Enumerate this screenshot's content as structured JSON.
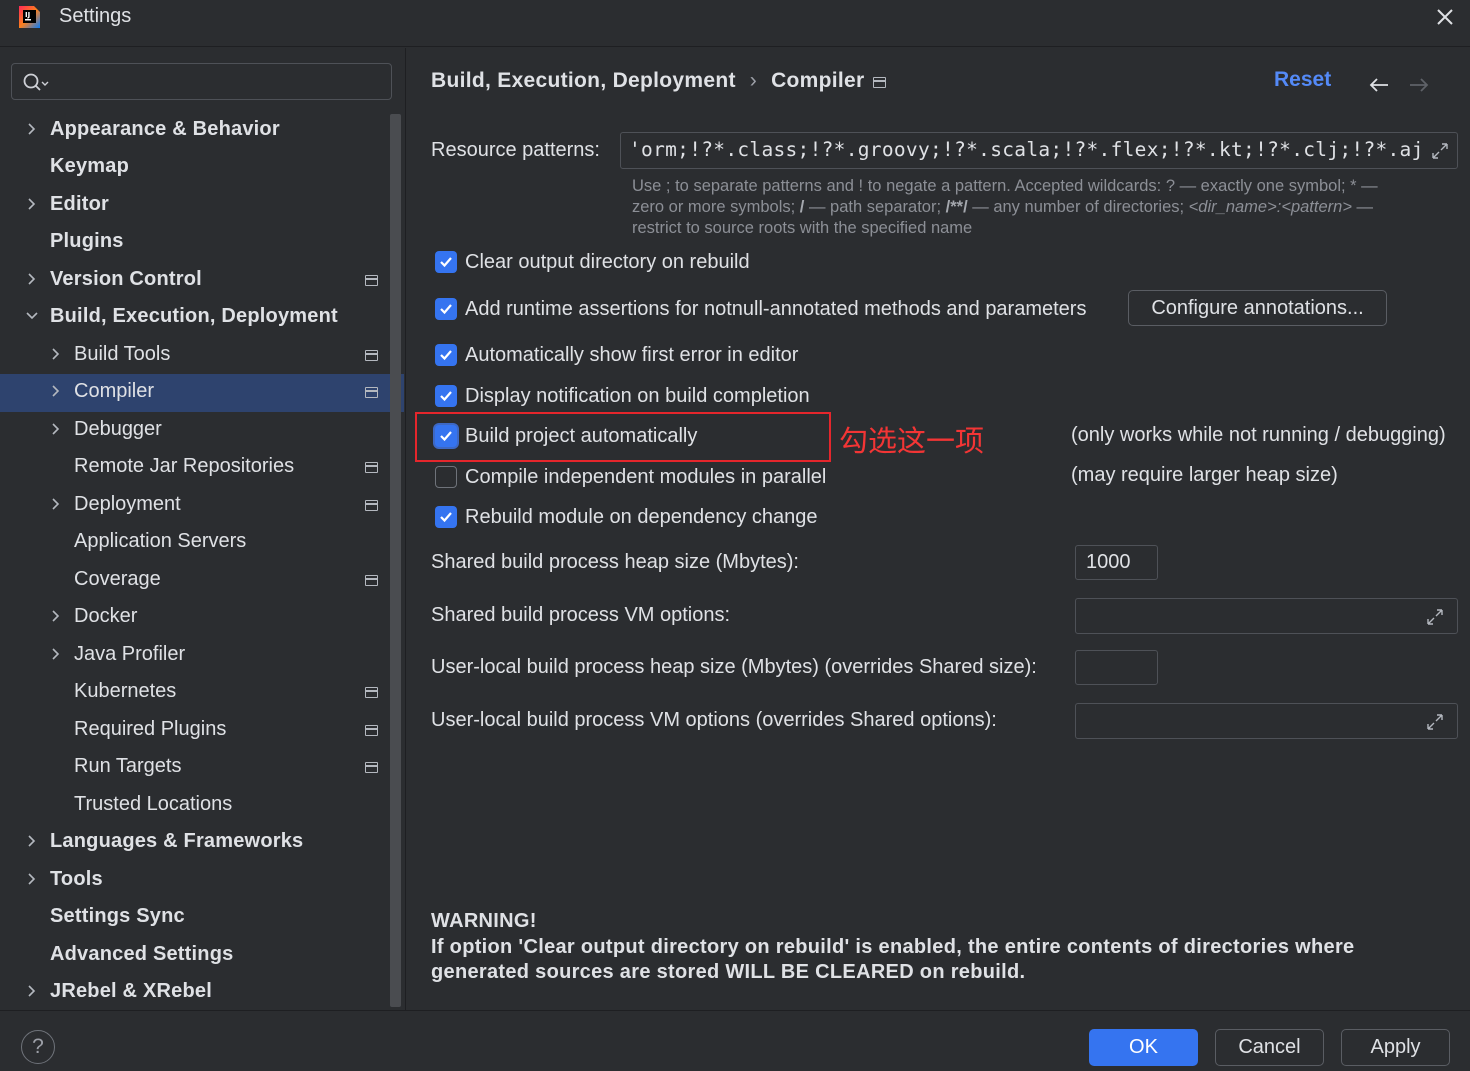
{
  "window": {
    "title": "Settings"
  },
  "search": {
    "placeholder": ""
  },
  "sidebar": {
    "items": [
      {
        "label": "Appearance & Behavior"
      },
      {
        "label": "Keymap"
      },
      {
        "label": "Editor"
      },
      {
        "label": "Plugins"
      },
      {
        "label": "Version Control"
      },
      {
        "label": "Build, Execution, Deployment"
      },
      {
        "label": "Build Tools"
      },
      {
        "label": "Compiler"
      },
      {
        "label": "Debugger"
      },
      {
        "label": "Remote Jar Repositories"
      },
      {
        "label": "Deployment"
      },
      {
        "label": "Application Servers"
      },
      {
        "label": "Coverage"
      },
      {
        "label": "Docker"
      },
      {
        "label": "Java Profiler"
      },
      {
        "label": "Kubernetes"
      },
      {
        "label": "Required Plugins"
      },
      {
        "label": "Run Targets"
      },
      {
        "label": "Trusted Locations"
      },
      {
        "label": "Languages & Frameworks"
      },
      {
        "label": "Tools"
      },
      {
        "label": "Settings Sync"
      },
      {
        "label": "Advanced Settings"
      },
      {
        "label": "JRebel & XRebel"
      }
    ]
  },
  "header": {
    "breadcrumb_parent": "Build, Execution, Deployment",
    "breadcrumb_separator": "›",
    "breadcrumb_current": "Compiler",
    "reset_label": "Reset"
  },
  "compiler": {
    "resource_patterns_label": "Resource patterns:",
    "resource_patterns_value": "'orm;!?*.class;!?*.groovy;!?*.scala;!?*.flex;!?*.kt;!?*.clj;!?*.aj",
    "hint_line1_a": "Use ; to separate patterns and ! to negate a pattern. Accepted wildcards: ? — exactly one symbol; * —",
    "hint_line2_a": "zero or more symbols; ",
    "hint_line2_b": "/",
    "hint_line2_c": " — path separator; ",
    "hint_line2_d": "/**/",
    "hint_line2_e": " — any number of directories; ",
    "hint_line2_f": "<dir_name>:<pattern>",
    "hint_line2_g": " —",
    "hint_line3": "restrict to source roots with the specified name",
    "options": [
      {
        "label": "Clear output directory on rebuild",
        "checked": true
      },
      {
        "label": "Add runtime assertions for notnull-annotated methods and parameters",
        "checked": true
      },
      {
        "label": "Automatically show first error in editor",
        "checked": true
      },
      {
        "label": "Display notification on build completion",
        "checked": true
      },
      {
        "label": "Build project automatically",
        "checked": true
      },
      {
        "label": "Compile independent modules in parallel",
        "checked": false
      },
      {
        "label": "Rebuild module on dependency change",
        "checked": true
      }
    ],
    "configure_annotations_label": "Configure annotations...",
    "build_auto_note": "(only works while not running / debugging)",
    "parallel_note": "(may require larger heap size)",
    "annotation_text": "勾选这一项",
    "shared_heap_label": "Shared build process heap size (Mbytes):",
    "shared_heap_value": "1000",
    "shared_vm_label": "Shared build process VM options:",
    "shared_vm_value": "",
    "user_heap_label": "User-local build process heap size (Mbytes) (overrides Shared size):",
    "user_heap_value": "",
    "user_vm_label": "User-local build process VM options (overrides Shared options):",
    "user_vm_value": "",
    "warning_title": "WARNING!",
    "warning_line1": "If option 'Clear output directory on rebuild' is enabled, the entire contents of directories where",
    "warning_line2": "generated sources are stored WILL BE CLEARED on rebuild."
  },
  "footer": {
    "help_label": "?",
    "ok_label": "OK",
    "cancel_label": "Cancel",
    "apply_label": "Apply"
  },
  "colors": {
    "accent": "#3574f0",
    "link": "#548af7",
    "selection": "#2e436e",
    "annotation_red": "#e5262c",
    "background": "#2b2d30"
  }
}
